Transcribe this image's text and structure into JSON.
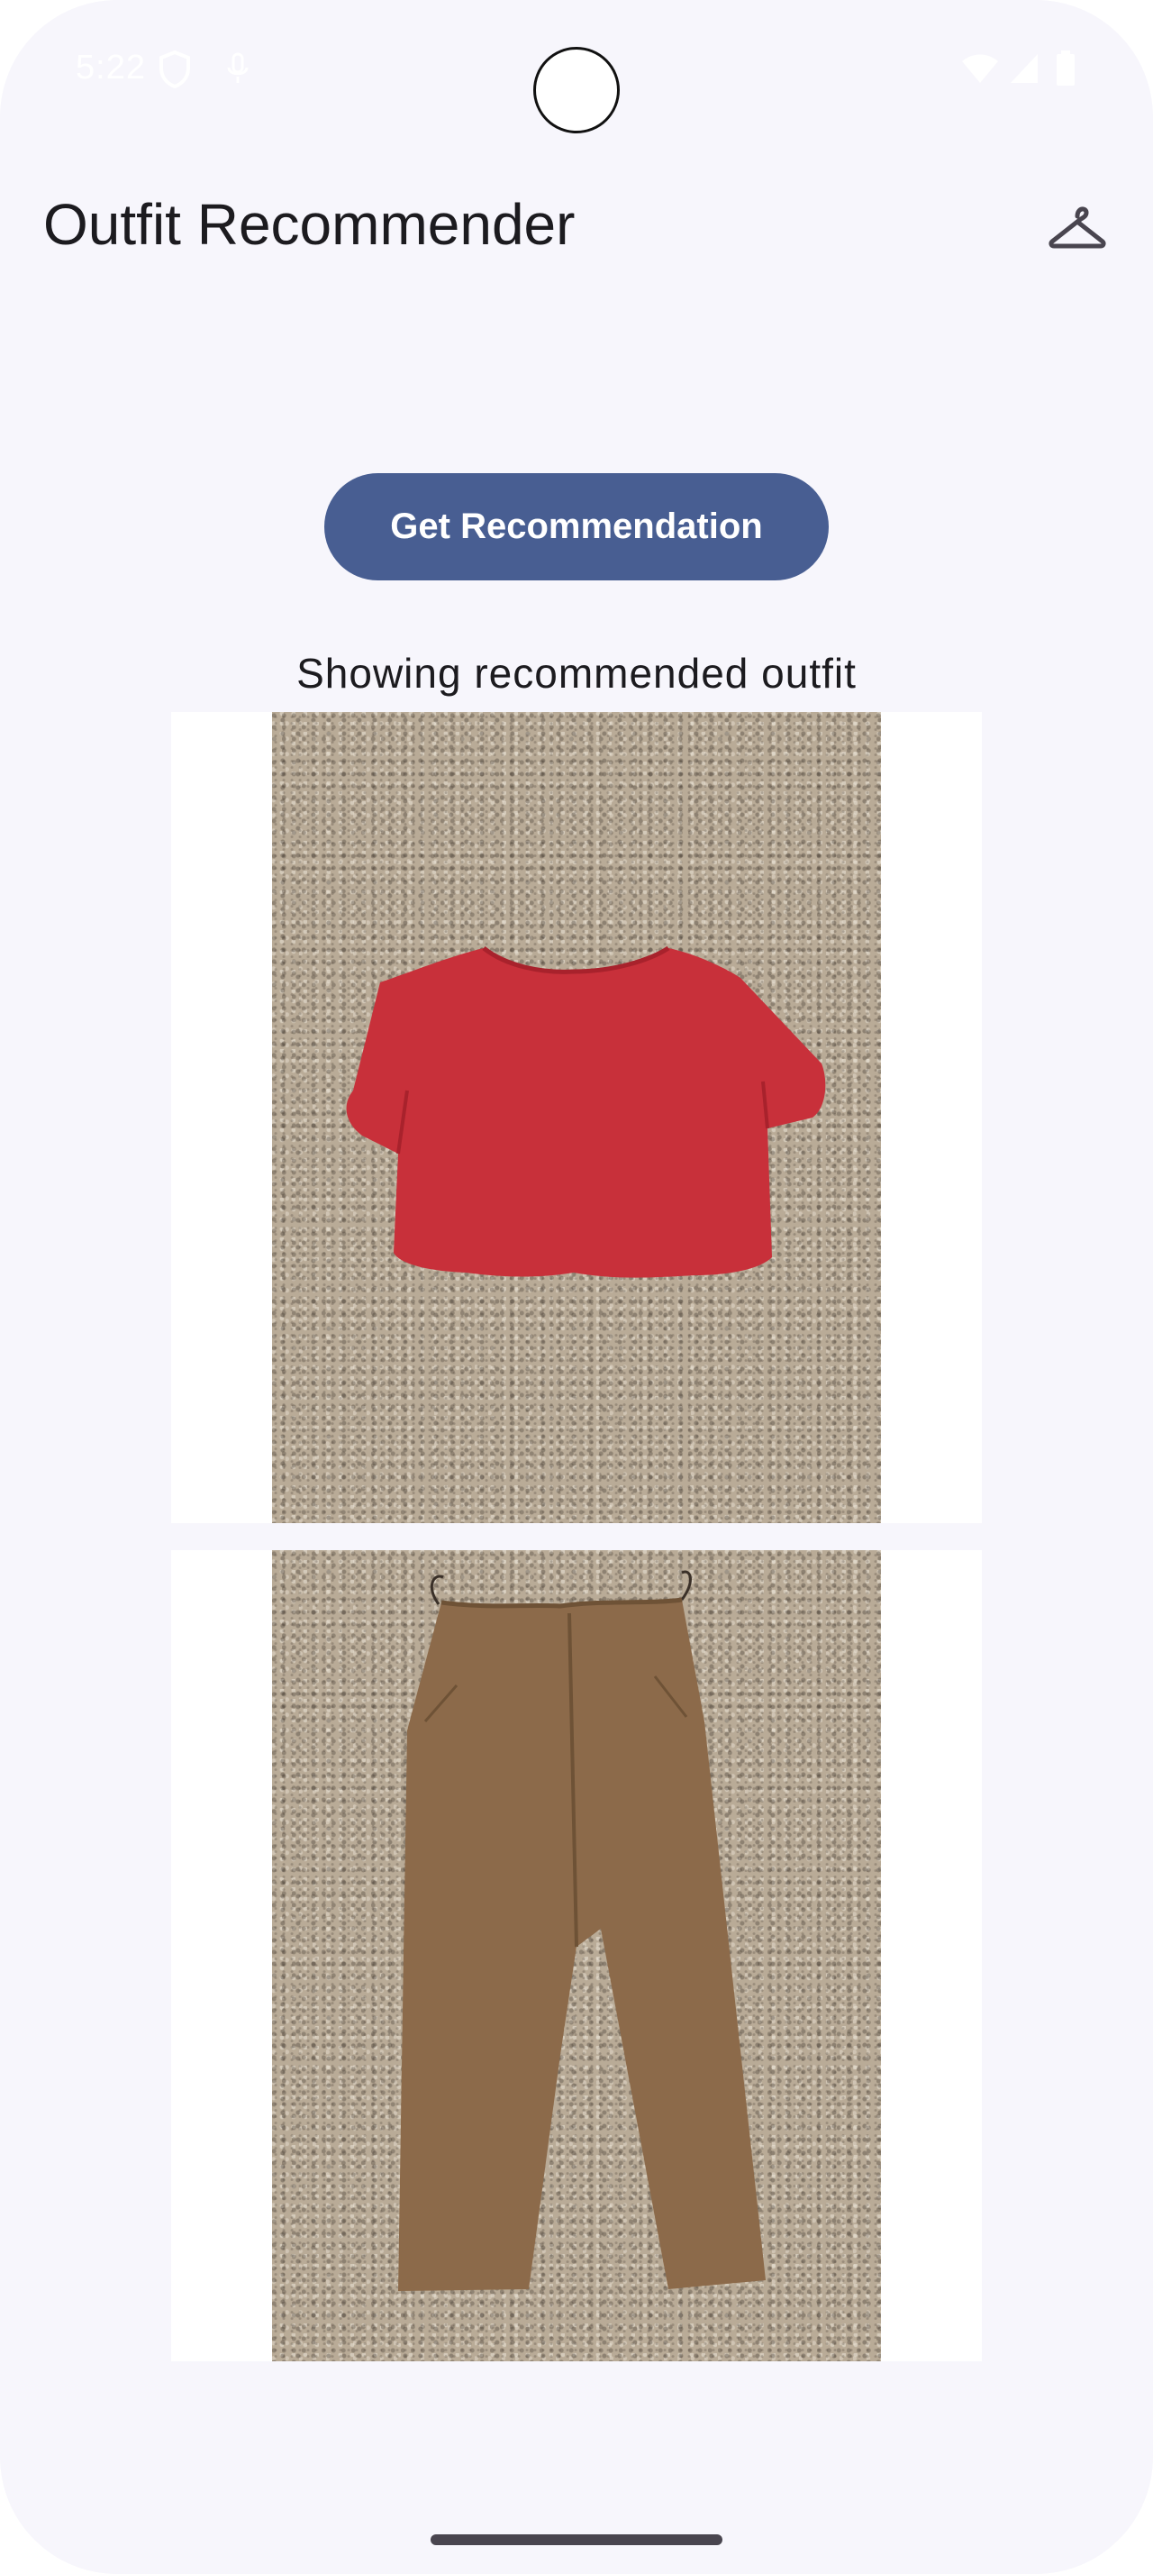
{
  "status_bar": {
    "time": "5:22",
    "icons": [
      "shield-icon",
      "mic-icon",
      "wifi-icon",
      "signal-icon",
      "battery-icon"
    ]
  },
  "app_bar": {
    "title": "Outfit Recommender",
    "action_icon": "hanger-icon"
  },
  "main": {
    "button_label": "Get Recommendation",
    "caption": "Showing recommended outfit",
    "outfit_items": [
      {
        "item": "red-tshirt-photo",
        "color": "#c8303a"
      },
      {
        "item": "brown-pants-photo",
        "color": "#8c6a4a"
      }
    ]
  },
  "colors": {
    "background": "#f7f6fc",
    "primary_button": "#485e92",
    "on_primary": "#ffffff",
    "text": "#1c1b1f"
  }
}
